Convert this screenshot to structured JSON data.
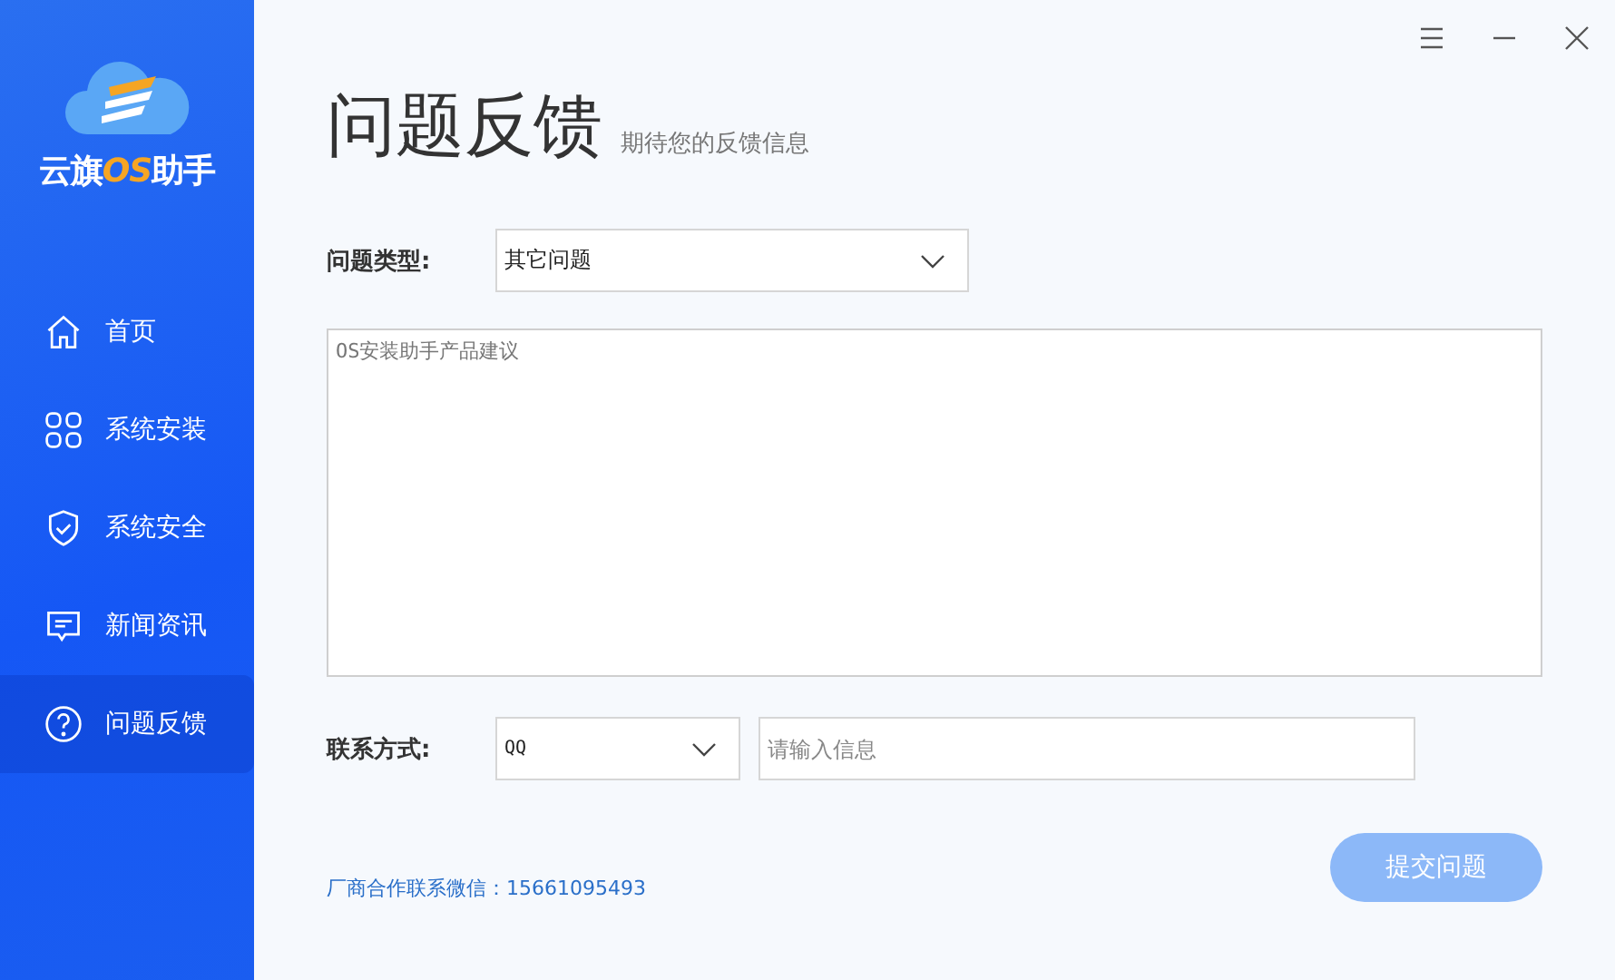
{
  "app": {
    "logo_parts": [
      "云旗",
      "OS",
      "助手"
    ]
  },
  "sidebar": {
    "items": [
      {
        "label": "首页",
        "selected": false
      },
      {
        "label": "系统安装",
        "selected": false
      },
      {
        "label": "系统安全",
        "selected": false
      },
      {
        "label": "新闻资讯",
        "selected": false
      },
      {
        "label": "问题反馈",
        "selected": true
      }
    ]
  },
  "page": {
    "title": "问题反馈",
    "subtitle": "期待您的反馈信息"
  },
  "form": {
    "type_label": "问题类型:",
    "type_value": "其它问题",
    "body_placeholder": "OS安装助手产品建议",
    "contact_label": "联系方式:",
    "contact_type": "QQ",
    "contact_placeholder": "请输入信息"
  },
  "footer": {
    "contact": "厂商合作联系微信：15661095493"
  },
  "submit": {
    "label": "提交问题",
    "disabled": true
  }
}
